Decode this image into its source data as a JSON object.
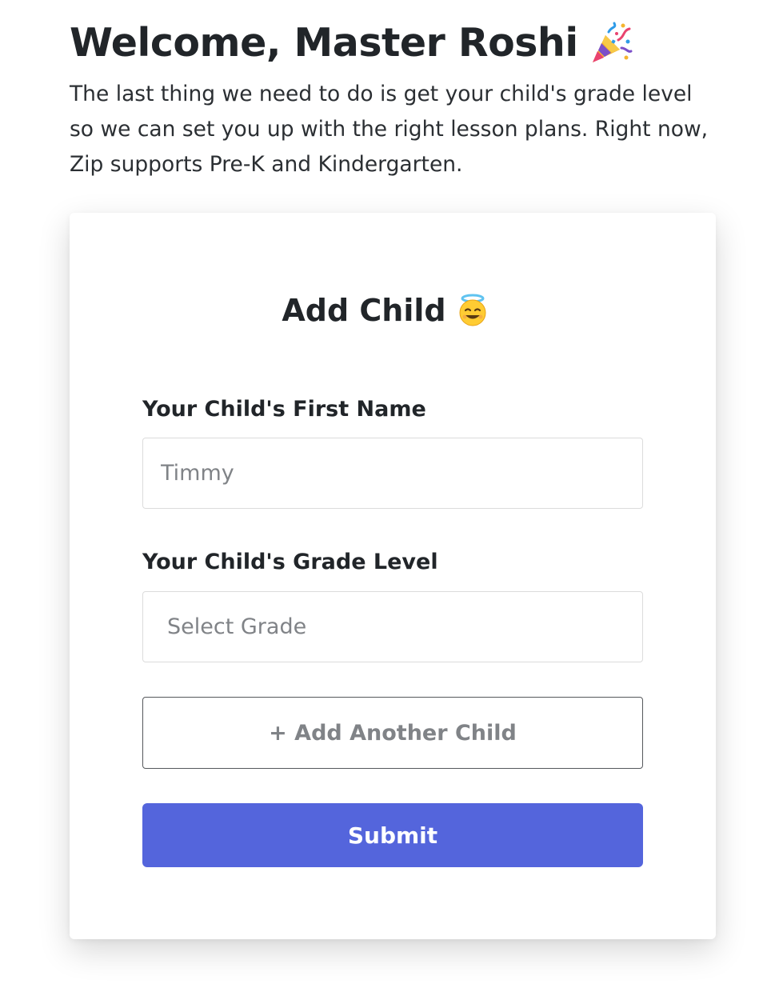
{
  "welcome": {
    "title": "Welcome, Master Roshi",
    "title_emoji": "party-popper-icon",
    "intro": "The last thing we need to do is get your child's grade level so we can set you up with the right lesson plans. Right now, Zip supports Pre-K and Kindergarten."
  },
  "form": {
    "title": "Add Child",
    "title_emoji": "smiling-face-with-halo-icon",
    "first_name_label": "Your Child's First Name",
    "first_name_placeholder": "Timmy",
    "first_name_value": "",
    "grade_label": "Your Child's Grade Level",
    "grade_selected": "Select Grade",
    "add_another_label": "+ Add Another Child",
    "submit_label": "Submit"
  },
  "colors": {
    "primary": "#5465DC",
    "text": "#212529",
    "placeholder": "#808387",
    "border": "#DCDCDC"
  }
}
